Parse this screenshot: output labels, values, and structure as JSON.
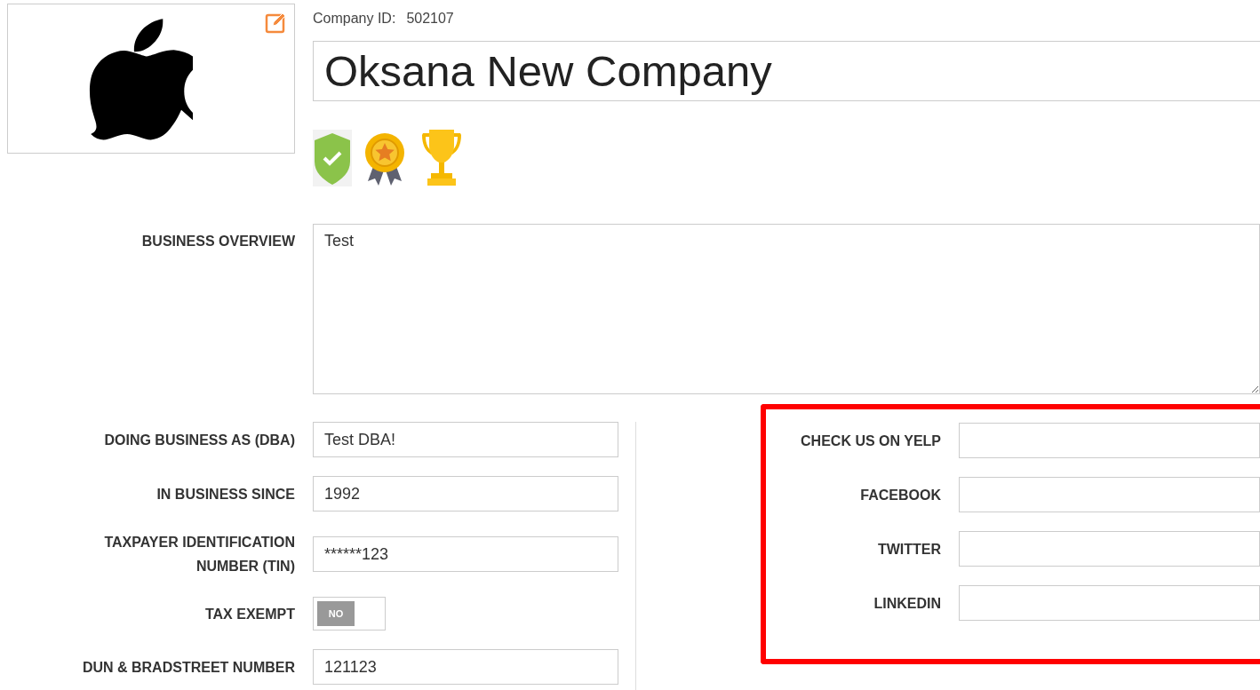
{
  "company": {
    "id_label": "Company ID:",
    "id_value": "502107",
    "name": "Oksana New Company"
  },
  "overview": {
    "label": "BUSINESS OVERVIEW",
    "value": "Test"
  },
  "details": [
    {
      "label": "DOING BUSINESS AS (DBA)",
      "kind": "text",
      "value": "Test DBA!"
    },
    {
      "label": "IN BUSINESS SINCE",
      "kind": "text",
      "value": "1992"
    },
    {
      "label": "TAXPAYER IDENTIFICATION NUMBER (TIN)",
      "kind": "text",
      "value": "******123"
    },
    {
      "label": "TAX EXEMPT",
      "kind": "toggle",
      "on": false,
      "value": "NO"
    },
    {
      "label": "DUN & BRADSTREET NUMBER",
      "kind": "text",
      "value": "121123"
    }
  ],
  "social": {
    "highlighted": true,
    "fields": [
      {
        "label": "CHECK US ON YELP"
      },
      {
        "label": "FACEBOOK"
      },
      {
        "label": "TWITTER"
      },
      {
        "label": "LINKEDIN"
      }
    ]
  }
}
